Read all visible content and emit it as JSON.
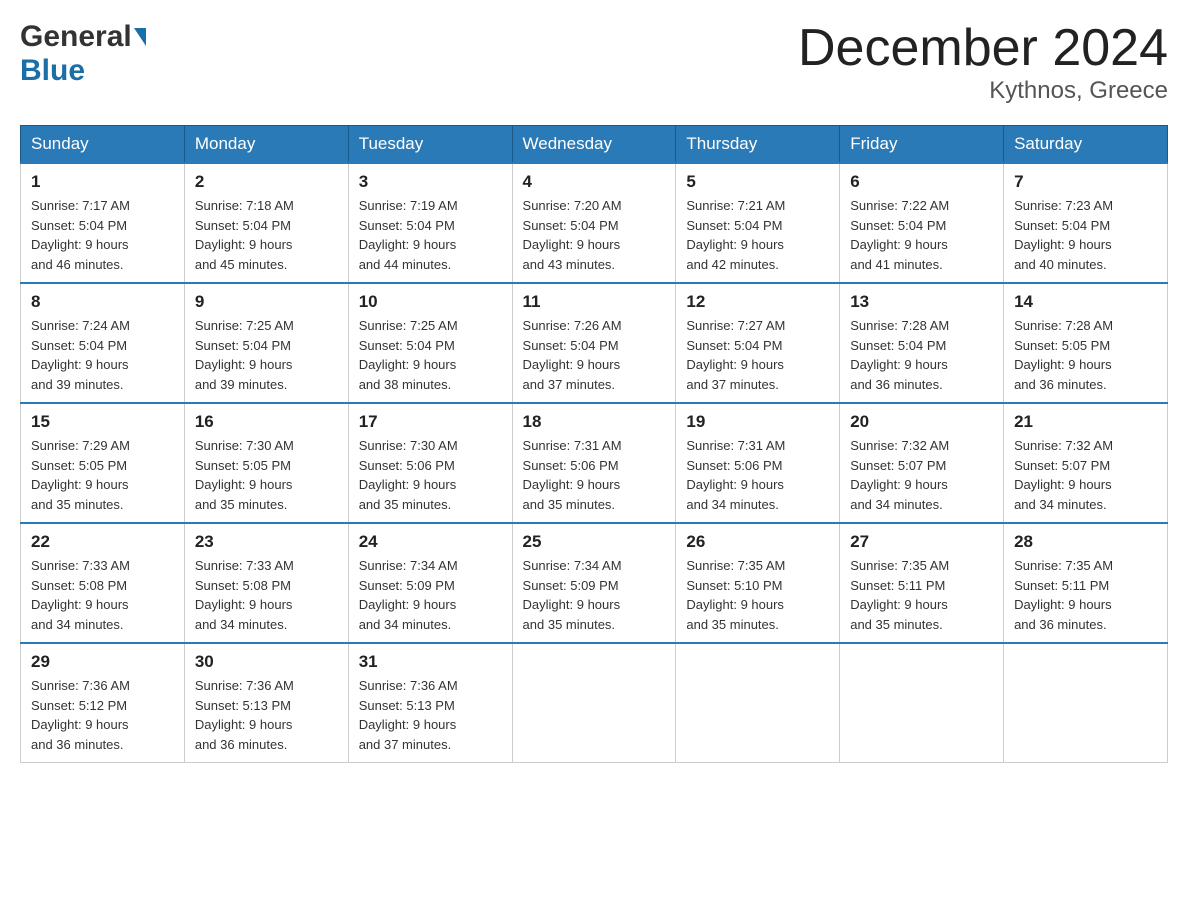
{
  "header": {
    "logo_general": "General",
    "logo_blue": "Blue",
    "title": "December 2024",
    "subtitle": "Kythnos, Greece"
  },
  "columns": [
    "Sunday",
    "Monday",
    "Tuesday",
    "Wednesday",
    "Thursday",
    "Friday",
    "Saturday"
  ],
  "weeks": [
    [
      {
        "day": "1",
        "sunrise": "7:17 AM",
        "sunset": "5:04 PM",
        "daylight": "9 hours and 46 minutes."
      },
      {
        "day": "2",
        "sunrise": "7:18 AM",
        "sunset": "5:04 PM",
        "daylight": "9 hours and 45 minutes."
      },
      {
        "day": "3",
        "sunrise": "7:19 AM",
        "sunset": "5:04 PM",
        "daylight": "9 hours and 44 minutes."
      },
      {
        "day": "4",
        "sunrise": "7:20 AM",
        "sunset": "5:04 PM",
        "daylight": "9 hours and 43 minutes."
      },
      {
        "day": "5",
        "sunrise": "7:21 AM",
        "sunset": "5:04 PM",
        "daylight": "9 hours and 42 minutes."
      },
      {
        "day": "6",
        "sunrise": "7:22 AM",
        "sunset": "5:04 PM",
        "daylight": "9 hours and 41 minutes."
      },
      {
        "day": "7",
        "sunrise": "7:23 AM",
        "sunset": "5:04 PM",
        "daylight": "9 hours and 40 minutes."
      }
    ],
    [
      {
        "day": "8",
        "sunrise": "7:24 AM",
        "sunset": "5:04 PM",
        "daylight": "9 hours and 39 minutes."
      },
      {
        "day": "9",
        "sunrise": "7:25 AM",
        "sunset": "5:04 PM",
        "daylight": "9 hours and 39 minutes."
      },
      {
        "day": "10",
        "sunrise": "7:25 AM",
        "sunset": "5:04 PM",
        "daylight": "9 hours and 38 minutes."
      },
      {
        "day": "11",
        "sunrise": "7:26 AM",
        "sunset": "5:04 PM",
        "daylight": "9 hours and 37 minutes."
      },
      {
        "day": "12",
        "sunrise": "7:27 AM",
        "sunset": "5:04 PM",
        "daylight": "9 hours and 37 minutes."
      },
      {
        "day": "13",
        "sunrise": "7:28 AM",
        "sunset": "5:04 PM",
        "daylight": "9 hours and 36 minutes."
      },
      {
        "day": "14",
        "sunrise": "7:28 AM",
        "sunset": "5:05 PM",
        "daylight": "9 hours and 36 minutes."
      }
    ],
    [
      {
        "day": "15",
        "sunrise": "7:29 AM",
        "sunset": "5:05 PM",
        "daylight": "9 hours and 35 minutes."
      },
      {
        "day": "16",
        "sunrise": "7:30 AM",
        "sunset": "5:05 PM",
        "daylight": "9 hours and 35 minutes."
      },
      {
        "day": "17",
        "sunrise": "7:30 AM",
        "sunset": "5:06 PM",
        "daylight": "9 hours and 35 minutes."
      },
      {
        "day": "18",
        "sunrise": "7:31 AM",
        "sunset": "5:06 PM",
        "daylight": "9 hours and 35 minutes."
      },
      {
        "day": "19",
        "sunrise": "7:31 AM",
        "sunset": "5:06 PM",
        "daylight": "9 hours and 34 minutes."
      },
      {
        "day": "20",
        "sunrise": "7:32 AM",
        "sunset": "5:07 PM",
        "daylight": "9 hours and 34 minutes."
      },
      {
        "day": "21",
        "sunrise": "7:32 AM",
        "sunset": "5:07 PM",
        "daylight": "9 hours and 34 minutes."
      }
    ],
    [
      {
        "day": "22",
        "sunrise": "7:33 AM",
        "sunset": "5:08 PM",
        "daylight": "9 hours and 34 minutes."
      },
      {
        "day": "23",
        "sunrise": "7:33 AM",
        "sunset": "5:08 PM",
        "daylight": "9 hours and 34 minutes."
      },
      {
        "day": "24",
        "sunrise": "7:34 AM",
        "sunset": "5:09 PM",
        "daylight": "9 hours and 34 minutes."
      },
      {
        "day": "25",
        "sunrise": "7:34 AM",
        "sunset": "5:09 PM",
        "daylight": "9 hours and 35 minutes."
      },
      {
        "day": "26",
        "sunrise": "7:35 AM",
        "sunset": "5:10 PM",
        "daylight": "9 hours and 35 minutes."
      },
      {
        "day": "27",
        "sunrise": "7:35 AM",
        "sunset": "5:11 PM",
        "daylight": "9 hours and 35 minutes."
      },
      {
        "day": "28",
        "sunrise": "7:35 AM",
        "sunset": "5:11 PM",
        "daylight": "9 hours and 36 minutes."
      }
    ],
    [
      {
        "day": "29",
        "sunrise": "7:36 AM",
        "sunset": "5:12 PM",
        "daylight": "9 hours and 36 minutes."
      },
      {
        "day": "30",
        "sunrise": "7:36 AM",
        "sunset": "5:13 PM",
        "daylight": "9 hours and 36 minutes."
      },
      {
        "day": "31",
        "sunrise": "7:36 AM",
        "sunset": "5:13 PM",
        "daylight": "9 hours and 37 minutes."
      },
      null,
      null,
      null,
      null
    ]
  ],
  "labels": {
    "sunrise": "Sunrise:",
    "sunset": "Sunset:",
    "daylight": "Daylight:"
  }
}
